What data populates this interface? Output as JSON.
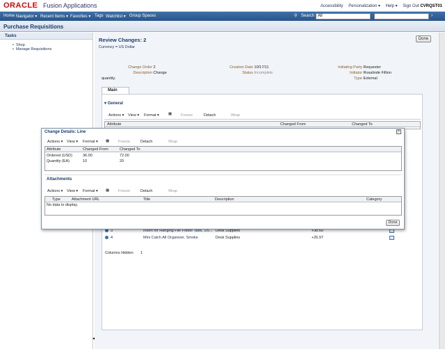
{
  "app": {
    "brand": "ORACLE",
    "name": "Fusion Applications"
  },
  "top_links": {
    "accessibility": "Accessibility",
    "personalization": "Personalization ▾",
    "help": "Help ▾",
    "signout": "Sign Out",
    "user": "CVRQST01"
  },
  "nav": {
    "items": [
      "Home",
      "Navigator ▾",
      "Recent Items ▾",
      "Favorites ▾",
      "Tags",
      "Watchlist ▾",
      "Group Spaces"
    ],
    "search_label": "Search",
    "search_scope": "All"
  },
  "page": {
    "title": "Purchase Requisitions"
  },
  "tasks": {
    "header": "Tasks",
    "items": [
      "Shop",
      "Manage Requisitions"
    ]
  },
  "review": {
    "title": "Review Changes: 2",
    "currency": "Currency = US Dollar",
    "done": "Done",
    "fields": {
      "change_order_label": "Change Order",
      "change_order": "2",
      "description_label": "Description",
      "description": "Change quantity.",
      "creation_date_label": "Creation Date",
      "creation_date": "10/17/11",
      "status_label": "Status",
      "status": "Incomplete",
      "initiating_party_label": "Initiating Party",
      "initiating_party": "Requester",
      "initiator_label": "Initiator",
      "initiator": "Rosalinde Fillion",
      "type_label": "Type",
      "type": "External"
    },
    "tab_main": "Main",
    "general": "General",
    "toolbar": {
      "actions": "Actions ▾",
      "view": "View ▾",
      "format": "Format ▾",
      "freeze": "Freeze",
      "detach": "Detach",
      "wrap": "Wrap"
    },
    "table_headers": [
      "Attribute",
      "Changed From",
      "Changed To"
    ],
    "lines": [
      {
        "num": "3",
        "desc": "Insert for Hanging File Folder Tabs, 1/5...",
        "cat": "Desk Supplies",
        "amt": "+38.60"
      },
      {
        "num": "4",
        "desc": "Mini Catch All Organizer, Smoke",
        "cat": "Desk Supplies",
        "amt": "+26.97"
      }
    ],
    "columns_hidden_label": "Columns Hidden",
    "columns_hidden": "1"
  },
  "dialog": {
    "title": "Change Details: Line",
    "toolbar": {
      "actions": "Actions ▾",
      "view": "View ▾",
      "format": "Format ▾",
      "freeze": "Freeze",
      "detach": "Detach",
      "wrap": "Wrap"
    },
    "headers": [
      "Attribute",
      "Changed From",
      "Changed To"
    ],
    "rows": [
      {
        "attr": "Ordered (USD)",
        "from": "36.00",
        "to": "72.00"
      },
      {
        "attr": "Quantity (EA)",
        "from": "10",
        "to": "20"
      }
    ],
    "attachments_title": "Attachments",
    "attachments_toolbar": {
      "actions": "Actions ▾",
      "view": "View ▾",
      "format": "Format ▾",
      "freeze": "Freeze",
      "detach": "Detach",
      "wrap": "Wrap"
    },
    "attachment_headers": [
      "Type",
      "Attachment URL",
      "Title",
      "Description",
      "Category"
    ],
    "no_data": "No data to display.",
    "done": "Done"
  },
  "colors": {
    "nav_bg": "#2f5b92",
    "brand_red": "#dd0000",
    "title_blue": "#1a3d6d",
    "label_brown": "#886030"
  }
}
